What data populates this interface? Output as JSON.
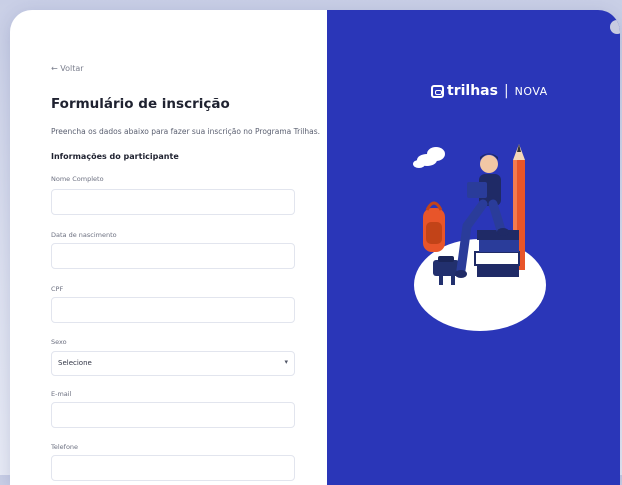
{
  "nav": {
    "back_label": "← Voltar"
  },
  "form": {
    "title": "Formulário de inscrição",
    "description": "Preencha os dados abaixo para fazer sua inscrição no Programa Trilhas.",
    "section_title": "Informações do participante",
    "fields": {
      "name": {
        "label": "Nome Completo",
        "value": ""
      },
      "birth": {
        "label": "Data de nascimento",
        "value": ""
      },
      "cpf": {
        "label": "CPF",
        "value": ""
      },
      "sex": {
        "label": "Sexo",
        "selected": "Selecione"
      },
      "email": {
        "label": "E-mail",
        "value": ""
      },
      "phone": {
        "label": "Telefone",
        "value": ""
      }
    }
  },
  "brand": {
    "logo_text": "trilhas",
    "separator": "|",
    "partner": "NOVA",
    "colors": {
      "panel": "#2a36b8",
      "accent": "#e8552a"
    }
  }
}
